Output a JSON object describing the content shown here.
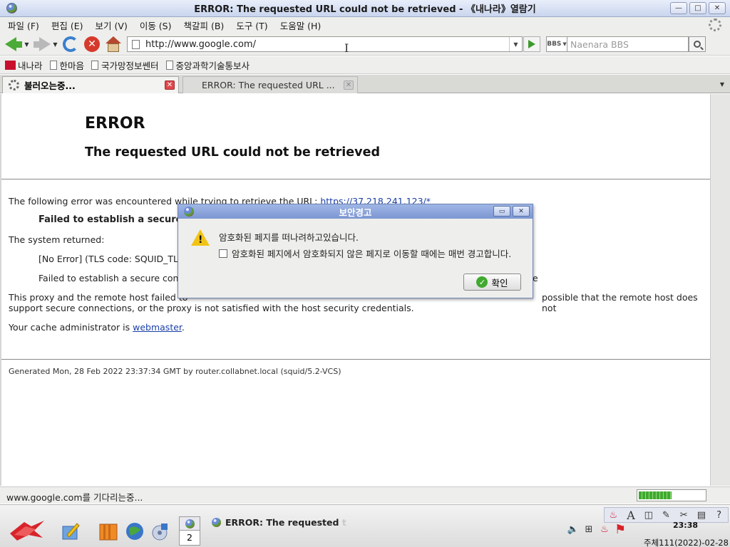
{
  "window": {
    "title": "ERROR: The requested URL could not be retrieved - 《내나라》열람기"
  },
  "menu": [
    "파일 (F)",
    "편집 (E)",
    "보기 (V)",
    "이동 (S)",
    "책갈피 (B)",
    "도구 (T)",
    "도움말 (H)"
  ],
  "toolbar": {
    "url": "http://www.google.com/",
    "search_engine": "BBS",
    "search_placeholder": "Naenara BBS"
  },
  "bookmarks": [
    "내나라",
    "한마음",
    "국가망정보쎈터",
    "중앙과학기술통보사"
  ],
  "tabs": [
    {
      "label": "불러오는중...",
      "active": true
    },
    {
      "label": "ERROR: The requested URL ...",
      "active": false
    }
  ],
  "page": {
    "error_title": "ERROR",
    "error_subtitle": "The requested URL could not be retrieved",
    "intro_text": "The following error was encountered while trying to retrieve the URL: ",
    "intro_link": "https://37.218.241.123/*",
    "failed_heading": "Failed to establish a secure",
    "system_returned": "The system returned:",
    "system_error": "[No Error] (TLS code: SQUID_TLS",
    "failed_detail": "Failed to establish a secure conn",
    "failed_detail_tail": "e",
    "proxy_text_left": "This proxy and the remote host failed to",
    "proxy_text_right": "possible that the remote host does not",
    "proxy_text_line2": "support secure connections, or the proxy is not satisfied with the host security credentials.",
    "admin_text": "Your cache administrator is ",
    "admin_link": "webmaster",
    "admin_suffix": ".",
    "generated": "Generated Mon, 28 Feb 2022 23:37:34 GMT by router.collabnet.local (squid/5.2-VCS)"
  },
  "dialog": {
    "title": "보안경고",
    "message": "암호화된 페지를 떠나려하고있습니다.",
    "checkbox_label": "암호화된 페지에서 암호화되지 않은 페지로 이동할 때에는 매번 경고합니다.",
    "checkbox_checked": false,
    "ok_label": "확인"
  },
  "status": {
    "text": "www.google.com를 기다리는중...",
    "progress": 0.5
  },
  "taskbar": {
    "pager_current": "2",
    "task_title": "ERROR: The requested",
    "task_fade": "t",
    "clock": "23:38",
    "date": "주체111(2022)-02-28"
  }
}
